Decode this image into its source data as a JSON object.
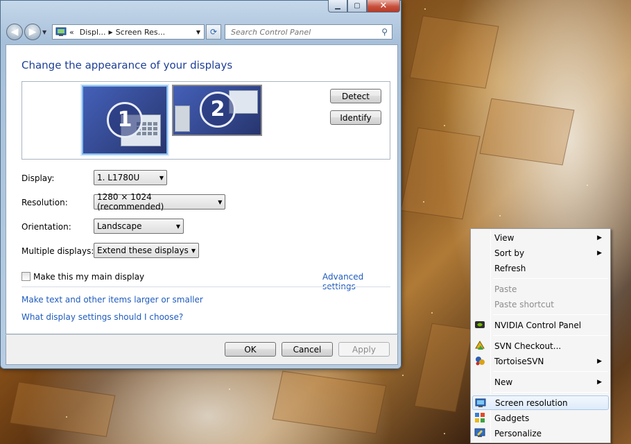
{
  "window": {
    "address_crumbs": [
      "«",
      "Displ...",
      "Screen Res..."
    ],
    "search_placeholder": "Search Control Panel",
    "title": "Change the appearance of your displays",
    "monitor_1": "1",
    "monitor_2": "2",
    "detect_label": "Detect",
    "identify_label": "Identify",
    "display_label": "Display:",
    "display_value": "1. L1780U",
    "resolution_label": "Resolution:",
    "resolution_value": "1280 × 1024 (recommended)",
    "orientation_label": "Orientation:",
    "orientation_value": "Landscape",
    "multiple_label": "Multiple displays:",
    "multiple_value": "Extend these displays",
    "main_display_label": "Make this my main display",
    "advanced_link": "Advanced settings",
    "text_size_link": "Make text and other items larger or smaller",
    "help_link": "What display settings should I choose?",
    "ok_label": "OK",
    "cancel_label": "Cancel",
    "apply_label": "Apply"
  },
  "menu": {
    "view": "View",
    "sort_by": "Sort by",
    "refresh": "Refresh",
    "paste": "Paste",
    "paste_shortcut": "Paste shortcut",
    "nvidia": "NVIDIA Control Panel",
    "svn_checkout": "SVN Checkout...",
    "tortoise": "TortoiseSVN",
    "new": "New",
    "screen_resolution": "Screen resolution",
    "gadgets": "Gadgets",
    "personalize": "Personalize"
  }
}
